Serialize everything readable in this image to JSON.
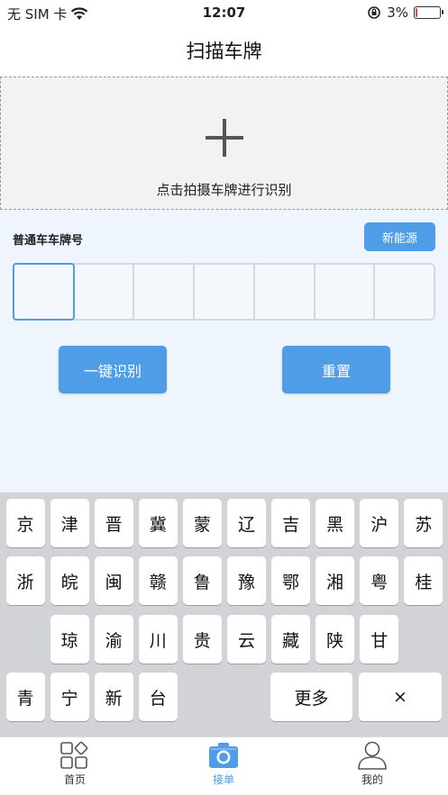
{
  "status_bar": {
    "carrier": "无 SIM 卡",
    "time": "12:07",
    "battery": "3%",
    "battery_level": 0.03
  },
  "nav": {
    "title": "扫描车牌"
  },
  "upload": {
    "label": "点击拍摄车牌进行识别"
  },
  "plate": {
    "type_label": "普通车车牌号",
    "new_energy_label": "新能源",
    "cells": [
      "",
      "",
      "",
      "",
      "",
      "",
      ""
    ],
    "recognize_label": "一键识别",
    "reset_label": "重置"
  },
  "keyboard": {
    "row1": [
      "京",
      "津",
      "晋",
      "冀",
      "蒙",
      "辽",
      "吉",
      "黑",
      "沪",
      "苏"
    ],
    "row2": [
      "浙",
      "皖",
      "闽",
      "赣",
      "鲁",
      "豫",
      "鄂",
      "湘",
      "粤",
      "桂"
    ],
    "row3": [
      "琼",
      "渝",
      "川",
      "贵",
      "云",
      "藏",
      "陕",
      "甘"
    ],
    "row4": [
      "青",
      "宁",
      "新",
      "台"
    ],
    "more_label": "更多",
    "delete_label": "×"
  },
  "tabs": [
    {
      "label": "首页",
      "icon": "home-grid-icon"
    },
    {
      "label": "接单",
      "icon": "camera-icon"
    },
    {
      "label": "我的",
      "icon": "user-icon"
    }
  ],
  "colors": {
    "accent": "#4e9de6",
    "keyboard_bg": "#d2d3d7",
    "panel_bg": "#eef5fd"
  }
}
